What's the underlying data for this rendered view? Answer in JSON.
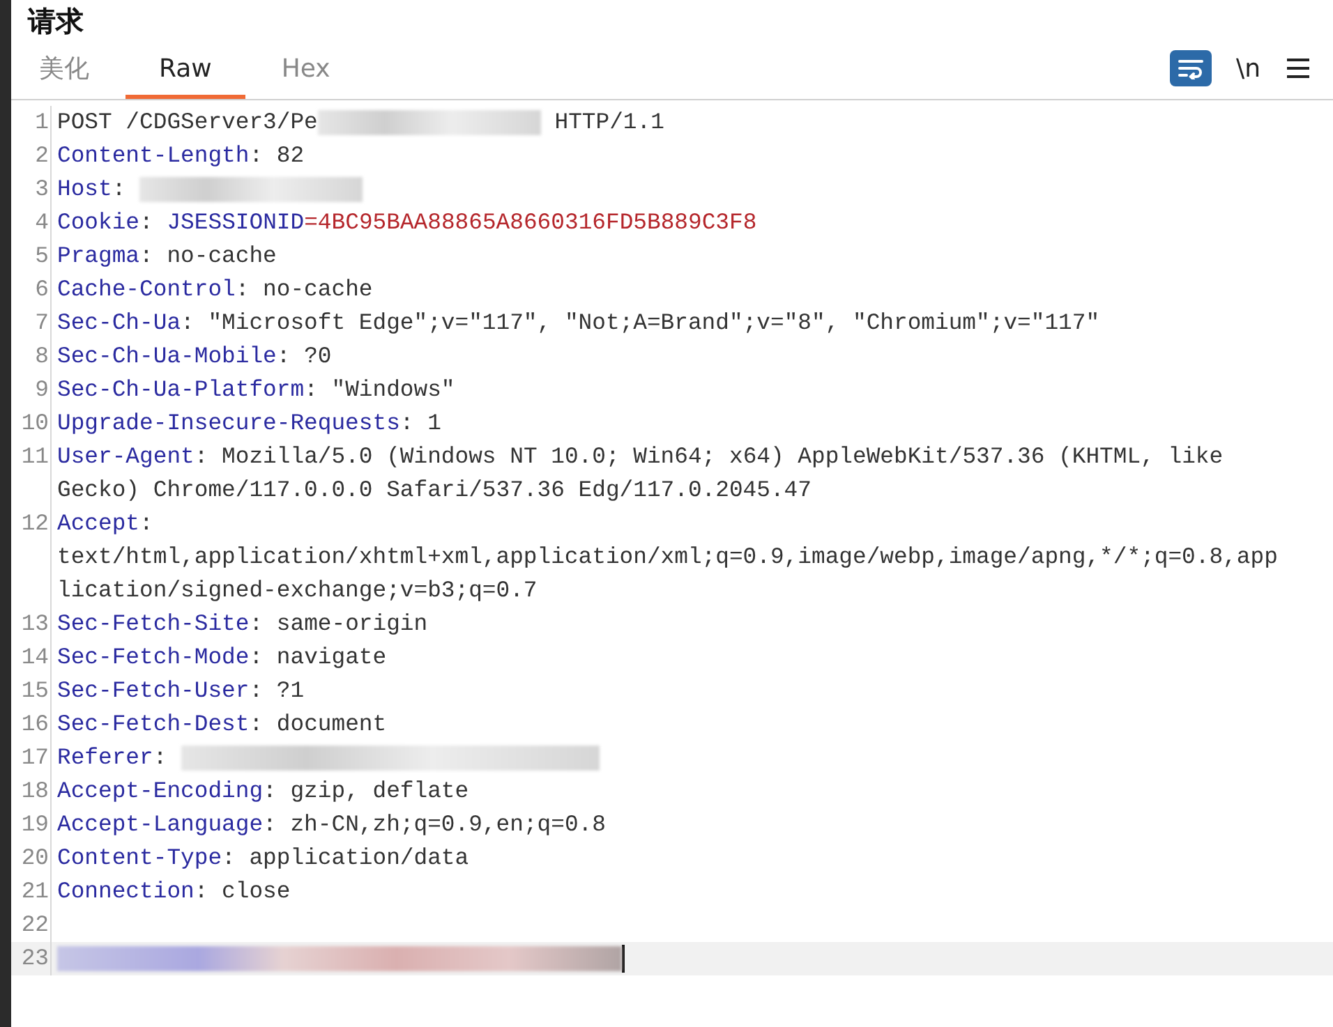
{
  "title": "请求",
  "tabs": [
    {
      "label": "美化",
      "selected": false
    },
    {
      "label": "Raw",
      "selected": true
    },
    {
      "label": "Hex",
      "selected": false
    }
  ],
  "toolbar": {
    "wrap_lines": {
      "on": true
    },
    "newline_button": {
      "label": "\\n",
      "on": false
    }
  },
  "lines": [
    {
      "number": "1",
      "parts": [
        {
          "kind": "text",
          "text": "POST /CDGServer3/Pe"
        },
        {
          "kind": "redacted-short"
        },
        {
          "kind": "text",
          "text": " HTTP/1.1"
        }
      ]
    },
    {
      "number": "2",
      "parts": [
        {
          "kind": "name",
          "text": "Content-Length"
        },
        {
          "kind": "text",
          "text": ": 82"
        }
      ]
    },
    {
      "number": "3",
      "parts": [
        {
          "kind": "name",
          "text": "Host"
        },
        {
          "kind": "text",
          "text": ": "
        },
        {
          "kind": "redacted-short"
        }
      ]
    },
    {
      "number": "4",
      "parts": [
        {
          "kind": "name",
          "text": "Cookie"
        },
        {
          "kind": "text",
          "text": ": "
        },
        {
          "kind": "name",
          "text": "JSESSIONID"
        },
        {
          "kind": "value",
          "text": "=4BC95BAA88865A8660316FD5B889C3F8"
        }
      ]
    },
    {
      "number": "5",
      "parts": [
        {
          "kind": "name",
          "text": "Pragma"
        },
        {
          "kind": "text",
          "text": ": no-cache"
        }
      ]
    },
    {
      "number": "6",
      "parts": [
        {
          "kind": "name",
          "text": "Cache-Control"
        },
        {
          "kind": "text",
          "text": ": no-cache"
        }
      ]
    },
    {
      "number": "7",
      "parts": [
        {
          "kind": "name",
          "text": "Sec-Ch-Ua"
        },
        {
          "kind": "text",
          "text": ": \"Microsoft Edge\";v=\"117\", \"Not;A=Brand\";v=\"8\", \"Chromium\";v=\"117\""
        }
      ]
    },
    {
      "number": "8",
      "parts": [
        {
          "kind": "name",
          "text": "Sec-Ch-Ua-Mobile"
        },
        {
          "kind": "text",
          "text": ": ?0"
        }
      ]
    },
    {
      "number": "9",
      "parts": [
        {
          "kind": "name",
          "text": "Sec-Ch-Ua-Platform"
        },
        {
          "kind": "text",
          "text": ": \"Windows\""
        }
      ]
    },
    {
      "number": "10",
      "parts": [
        {
          "kind": "name",
          "text": "Upgrade-Insecure-Requests"
        },
        {
          "kind": "text",
          "text": ": 1"
        }
      ]
    },
    {
      "number": "11",
      "parts": [
        {
          "kind": "name",
          "text": "User-Agent"
        },
        {
          "kind": "text",
          "text": ": Mozilla/5.0 (Windows NT 10.0; Win64; x64) AppleWebKit/537.36 (KHTML, like"
        }
      ],
      "continuation": [
        "Gecko) Chrome/117.0.0.0 Safari/537.36 Edg/117.0.2045.47"
      ]
    },
    {
      "number": "12",
      "parts": [
        {
          "kind": "name",
          "text": "Accept"
        },
        {
          "kind": "text",
          "text": ":"
        }
      ],
      "continuation": [
        "text/html,application/xhtml+xml,application/xml;q=0.9,image/webp,image/apng,*/*;q=0.8,app",
        "lication/signed-exchange;v=b3;q=0.7"
      ]
    },
    {
      "number": "13",
      "parts": [
        {
          "kind": "name",
          "text": "Sec-Fetch-Site"
        },
        {
          "kind": "text",
          "text": ": same-origin"
        }
      ]
    },
    {
      "number": "14",
      "parts": [
        {
          "kind": "name",
          "text": "Sec-Fetch-Mode"
        },
        {
          "kind": "text",
          "text": ": navigate"
        }
      ]
    },
    {
      "number": "15",
      "parts": [
        {
          "kind": "name",
          "text": "Sec-Fetch-User"
        },
        {
          "kind": "text",
          "text": ": ?1"
        }
      ]
    },
    {
      "number": "16",
      "parts": [
        {
          "kind": "name",
          "text": "Sec-Fetch-Dest"
        },
        {
          "kind": "text",
          "text": ": document"
        }
      ]
    },
    {
      "number": "17",
      "parts": [
        {
          "kind": "name",
          "text": "Referer"
        },
        {
          "kind": "text",
          "text": ": "
        },
        {
          "kind": "redacted-long"
        }
      ]
    },
    {
      "number": "18",
      "parts": [
        {
          "kind": "name",
          "text": "Accept-Encoding"
        },
        {
          "kind": "text",
          "text": ": gzip, deflate"
        }
      ]
    },
    {
      "number": "19",
      "parts": [
        {
          "kind": "name",
          "text": "Accept-Language"
        },
        {
          "kind": "text",
          "text": ": zh-CN,zh;q=0.9,en;q=0.8"
        }
      ]
    },
    {
      "number": "20",
      "parts": [
        {
          "kind": "name",
          "text": "Content-Type"
        },
        {
          "kind": "text",
          "text": ": application/data"
        }
      ]
    },
    {
      "number": "21",
      "parts": [
        {
          "kind": "name",
          "text": "Connection"
        },
        {
          "kind": "text",
          "text": ": close"
        }
      ]
    },
    {
      "number": "22"
    },
    {
      "number": "23",
      "current": true,
      "parts": [
        {
          "kind": "redacted-full"
        }
      ]
    }
  ]
}
